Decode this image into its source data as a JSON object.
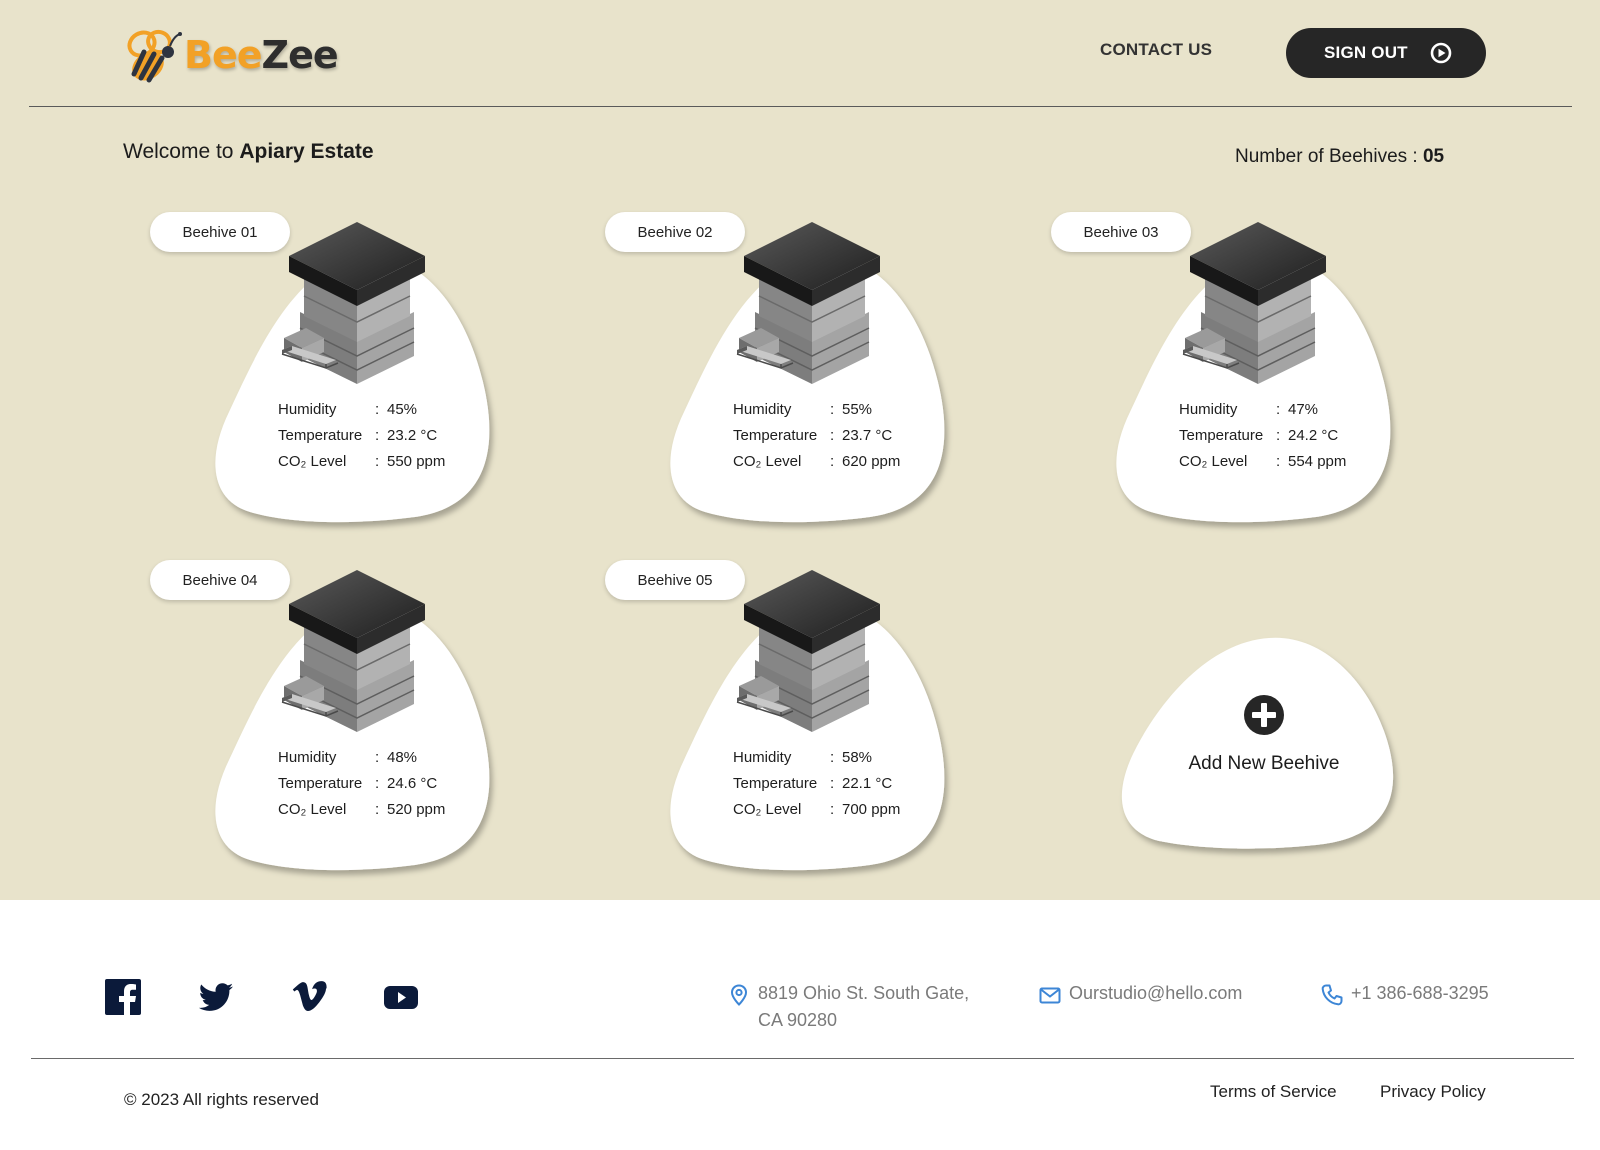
{
  "header": {
    "logo_part1": "Bee",
    "logo_part2": "Zee",
    "contact_label": "CONTACT US",
    "signout_label": "SIGN OUT",
    "signout_icon": "play-circle-icon"
  },
  "welcome": {
    "prefix": "Welcome to ",
    "estate": "Apiary Estate",
    "count_label": "Number of Beehives : ",
    "count_value": "05"
  },
  "labels": {
    "humidity": "Humidity",
    "temperature": "Temperature",
    "co2": "CO₂ Level",
    "colon": ":"
  },
  "hives": [
    {
      "name": "Beehive 01",
      "humidity": "45%",
      "temperature": "23.2 °C",
      "co2": "550 ppm"
    },
    {
      "name": "Beehive 02",
      "humidity": "55%",
      "temperature": "23.7 °C",
      "co2": "620 ppm"
    },
    {
      "name": "Beehive 03",
      "humidity": "47%",
      "temperature": "24.2 °C",
      "co2": "554 ppm"
    },
    {
      "name": "Beehive 04",
      "humidity": "48%",
      "temperature": "24.6 °C",
      "co2": "520 ppm"
    },
    {
      "name": "Beehive 05",
      "humidity": "58%",
      "temperature": "22.1 °C",
      "co2": "700 ppm"
    }
  ],
  "add_new": {
    "label": "Add New Beehive",
    "icon": "plus-circle-icon"
  },
  "footer": {
    "social": [
      "facebook-icon",
      "twitter-icon",
      "vimeo-icon",
      "youtube-icon"
    ],
    "address_line1": "8819 Ohio St. South Gate,",
    "address_line2": "CA 90280",
    "email": "Ourstudio@hello.com",
    "phone": "+1 386-688-3295",
    "copyright": "© 2023 All rights reserved",
    "terms": "Terms of Service",
    "privacy": "Privacy Policy"
  },
  "colors": {
    "background": "#e8e3cb",
    "dark": "#262626",
    "accent": "#f2a126",
    "footer_icon": "#3d86d6",
    "social_icon": "#0b1a3a"
  }
}
